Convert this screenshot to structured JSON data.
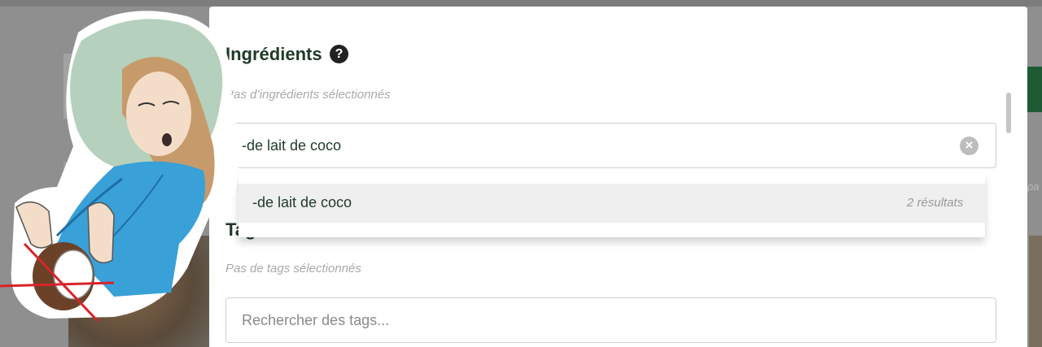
{
  "background": {
    "right_hint": "pa"
  },
  "ingredients": {
    "title": "Ingrédients",
    "help_glyph": "?",
    "hint": "Pas d’ingrédients sélectionnés",
    "search_value": "-de lait de coco",
    "clear_glyph": "×",
    "dropdown": {
      "items": [
        {
          "label": "-de lait de coco",
          "count": "2 résultats"
        }
      ]
    }
  },
  "tags": {
    "title": "Tags",
    "hint": "Pas de tags sélectionnés",
    "placeholder": "Rechercher des tags..."
  },
  "colors": {
    "text_dark_green": "#1f3a26",
    "hint_gray": "#a9a9a9",
    "overlay": "#8f8f8f",
    "illustration_blue": "#3aa0d8",
    "illustration_green_wash": "#a8c8b0",
    "cross_red": "#d8232a"
  },
  "icons": {
    "help": "question-circle-icon",
    "clear": "clear-circle-icon",
    "filter": "sliders-icon"
  }
}
